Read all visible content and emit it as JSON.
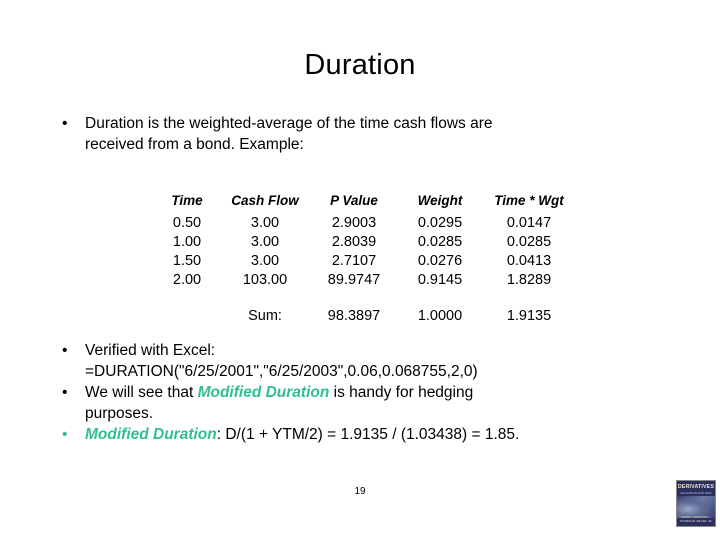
{
  "slide": {
    "title": "Duration",
    "page_number": "19",
    "bullet_marker": "•",
    "accent_color": "#2FBF93",
    "text_color": "#000000",
    "background_color": "#FFFFFF"
  },
  "bullets_top": [
    {
      "line1": "Duration is the weighted-average of the time cash flows are",
      "line2": "received from a bond. Example:"
    }
  ],
  "bullets_bottom": [
    {
      "line1": "Verified with Excel:",
      "line2": "=DURATION(\"6/25/2001\",\"6/25/2003\",0.06,0.068755,2,0)"
    },
    {
      "pre": "We will see that ",
      "accent": "Modified Duration",
      "post": " is handy for hedging",
      "line2": "purposes."
    },
    {
      "accent": "Modified Duration",
      "post": ":  D/(1 + YTM/2) = 1.9135 / (1.03438) = 1.85."
    }
  ],
  "table": {
    "headers": [
      "Time",
      "Cash Flow",
      "P Value",
      "Weight",
      "Time * Wgt"
    ],
    "rows": [
      [
        "0.50",
        "3.00",
        "2.9003",
        "0.0295",
        "0.0147"
      ],
      [
        "1.00",
        "3.00",
        "2.8039",
        "0.0285",
        "0.0285"
      ],
      [
        "1.50",
        "3.00",
        "2.7107",
        "0.0276",
        "0.0413"
      ],
      [
        "2.00",
        "103.00",
        "89.9747",
        "0.9145",
        "1.8289"
      ]
    ],
    "sum": {
      "label": "Sum:",
      "p_value": "98.3897",
      "weight": "1.0000",
      "time_wgt": "1.9135"
    }
  },
  "logo": {
    "title": "DERIVATIVES",
    "subtitle": "VALUATION AND RISK MANAGEMENT",
    "authors": "DAVID A. DUBOFSKY / THOMAS W. MILLER, JR."
  }
}
